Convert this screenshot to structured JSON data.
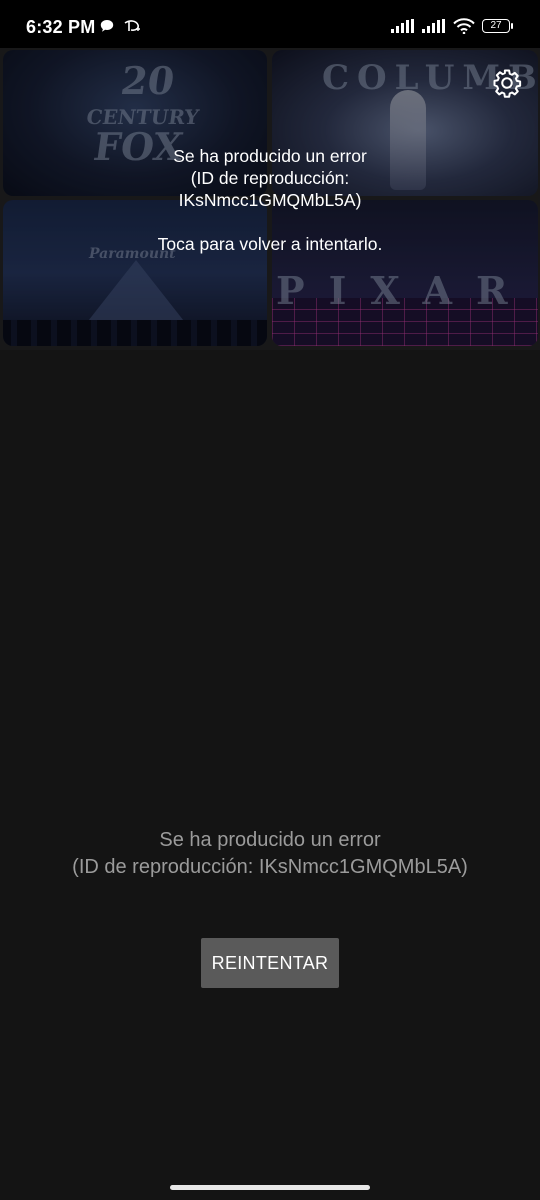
{
  "status_bar": {
    "time": "6:32 PM",
    "left_icons": [
      "chat-bubble-icon",
      "disney-plus-icon"
    ],
    "right_icons": [
      "signal-icon",
      "signal-icon",
      "wifi-icon",
      "battery-icon"
    ],
    "battery_level": "27"
  },
  "player": {
    "thumbnails": [
      {
        "name": "thumbnail-20th-century-fox",
        "logo_text": "20\nCENTURY\nFOX"
      },
      {
        "name": "thumbnail-columbia",
        "logo_text": "COLUMBIA"
      },
      {
        "name": "thumbnail-paramount",
        "logo_text": "Paramount"
      },
      {
        "name": "thumbnail-pixar",
        "logo_text": "PIXAR"
      }
    ],
    "settings_icon": "gear-icon",
    "overlay_error_line1": "Se ha producido un error",
    "overlay_error_line2": "(ID de reproducción:",
    "overlay_error_line3": "IKsNmcc1GMQMbL5A)",
    "overlay_retry_hint": "Toca para volver a intentarlo."
  },
  "content": {
    "error_line1": "Se ha producido un error",
    "error_line2": "(ID de reproducción: IKsNmcc1GMQMbL5A)",
    "retry_button": "REINTENTAR"
  },
  "colors": {
    "background": "#141414",
    "player_background": "#2a2a2c",
    "button_background": "#5a5a5a",
    "secondary_text": "#9b9b9b"
  }
}
